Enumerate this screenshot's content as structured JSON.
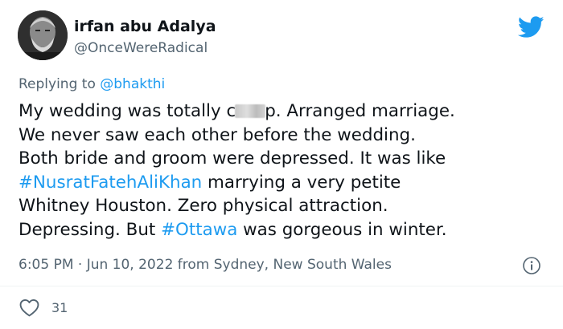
{
  "author": {
    "display_name": "irfan abu Adalya",
    "handle": "@OnceWereRadical",
    "avatar_icon": "user-avatar-photo"
  },
  "reply": {
    "prefix": "Replying to ",
    "mention": "@bhakthi"
  },
  "tweet": {
    "line1_before": "My wedding was totally c",
    "line1_after": "p. Arranged marriage.",
    "line2": "We never saw each other before the wedding.",
    "line3": "Both bride and groom were depressed. It was like",
    "hashtag1": "#NusratFatehAliKhan",
    "line4_after": " marrying a very petite",
    "line5": "Whitney Houston. Zero physical attraction.",
    "line6_before": "Depressing. But ",
    "hashtag2": "#Ottawa",
    "line6_after": " was gorgeous in winter."
  },
  "meta": {
    "timestamp": "6:05 PM · Jun 10, 2022 from Sydney, New South Wales"
  },
  "engagement": {
    "likes": "31"
  },
  "icons": {
    "brand": "twitter-bird-icon",
    "info": "info-icon",
    "like": "heart-icon"
  },
  "colors": {
    "accent": "#1d9bf0",
    "text": "#0f1419",
    "muted": "#536471"
  }
}
